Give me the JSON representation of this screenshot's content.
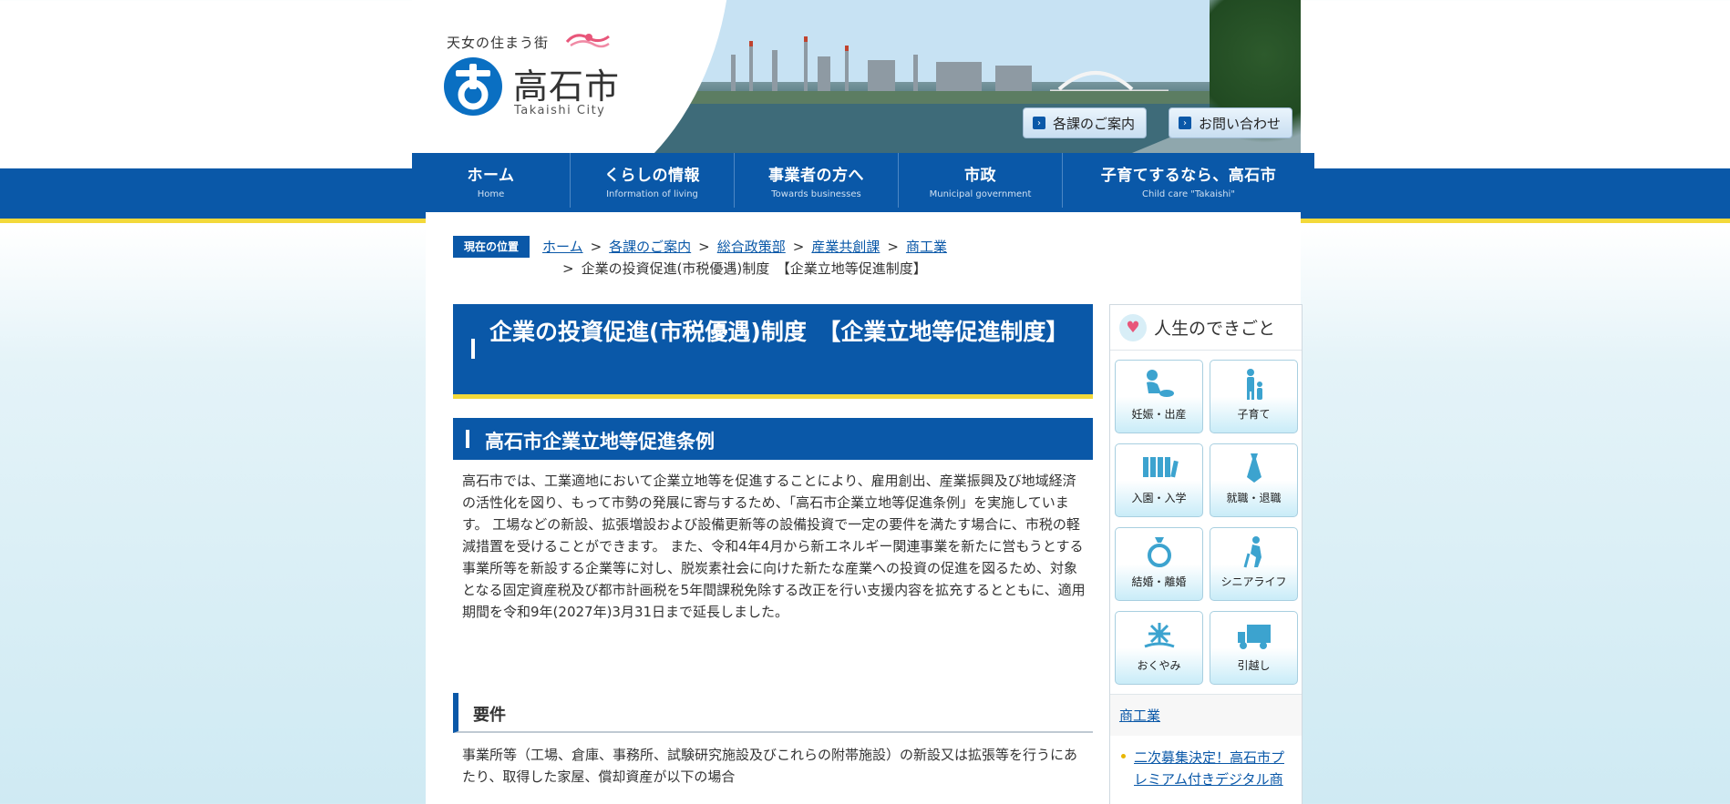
{
  "header": {
    "tagline": "天女の住まう街",
    "logo_text": "高石市",
    "logo_sub": "Takaishi City",
    "buttons": [
      {
        "label": "各課のご案内"
      },
      {
        "label": "お問い合わせ"
      }
    ]
  },
  "nav": [
    {
      "jp": "ホーム",
      "en": "Home"
    },
    {
      "jp": "くらしの情報",
      "en": "Information of living"
    },
    {
      "jp": "事業者の方へ",
      "en": "Towards businesses"
    },
    {
      "jp": "市政",
      "en": "Municipal government"
    },
    {
      "jp": "子育てするなら、高石市",
      "en": "Child care \"Takaishi\""
    }
  ],
  "breadcrumb": {
    "badge": "現在の位置",
    "links": [
      "ホーム",
      "各課のご案内",
      "総合政策部",
      "産業共創課",
      "商工業"
    ],
    "current": "企業の投資促進(市税優遇)制度　【企業立地等促進制度】"
  },
  "main": {
    "title": "企業の投資促進(市税優遇)制度　【企業立地等促進制度】",
    "h2": "高石市企業立地等促進条例",
    "paragraph": "高石市では、工業適地において企業立地等を促進することにより、雇用創出、産業振興及び地域経済の活性化を図り、もって市勢の発展に寄与するため、「高石市企業立地等促進条例」を実施しています。 工場などの新設、拡張増設および設備更新等の設備投資で一定の要件を満たす場合に、市税の軽減措置を受けることができます。 また、令和4年4月から新エネルギー関連事業を新たに営もうとする事業所等を新設する企業等に対し、脱炭素社会に向けた新たな産業への投資の促進を図るため、対象となる固定資産税及び都市計画税を5年間課税免除する改正を行い支援内容を拡充するとともに、適用期間を令和9年(2027年)3月31日まで延長しました。",
    "h3": "要件",
    "paragraph2": "事業所等（工場、倉庫、事務所、試験研究施設及びこれらの附帯施設）の新設又は拡張等を行うにあたり、取得した家屋、償却資産が以下の場合"
  },
  "sidebar": {
    "title": "人生のできごと",
    "tiles": [
      {
        "label": "妊娠・出産",
        "icon": "baby-icon"
      },
      {
        "label": "子育て",
        "icon": "parent-child-icon"
      },
      {
        "label": "入園・入学",
        "icon": "school-bags-icon"
      },
      {
        "label": "就職・退職",
        "icon": "necktie-icon"
      },
      {
        "label": "結婚・離婚",
        "icon": "ring-icon"
      },
      {
        "label": "シニアライフ",
        "icon": "senior-icon"
      },
      {
        "label": "おくやみ",
        "icon": "flower-icon"
      },
      {
        "label": "引越し",
        "icon": "truck-icon"
      }
    ],
    "category_link": "商工業",
    "list": [
      "二次募集決定！高石市プレミアム付きデジタル商"
    ]
  },
  "colors": {
    "brand_blue": "#0a58a8",
    "accent_yellow": "#f3d93a",
    "tile_icon": "#3ca3cf"
  }
}
